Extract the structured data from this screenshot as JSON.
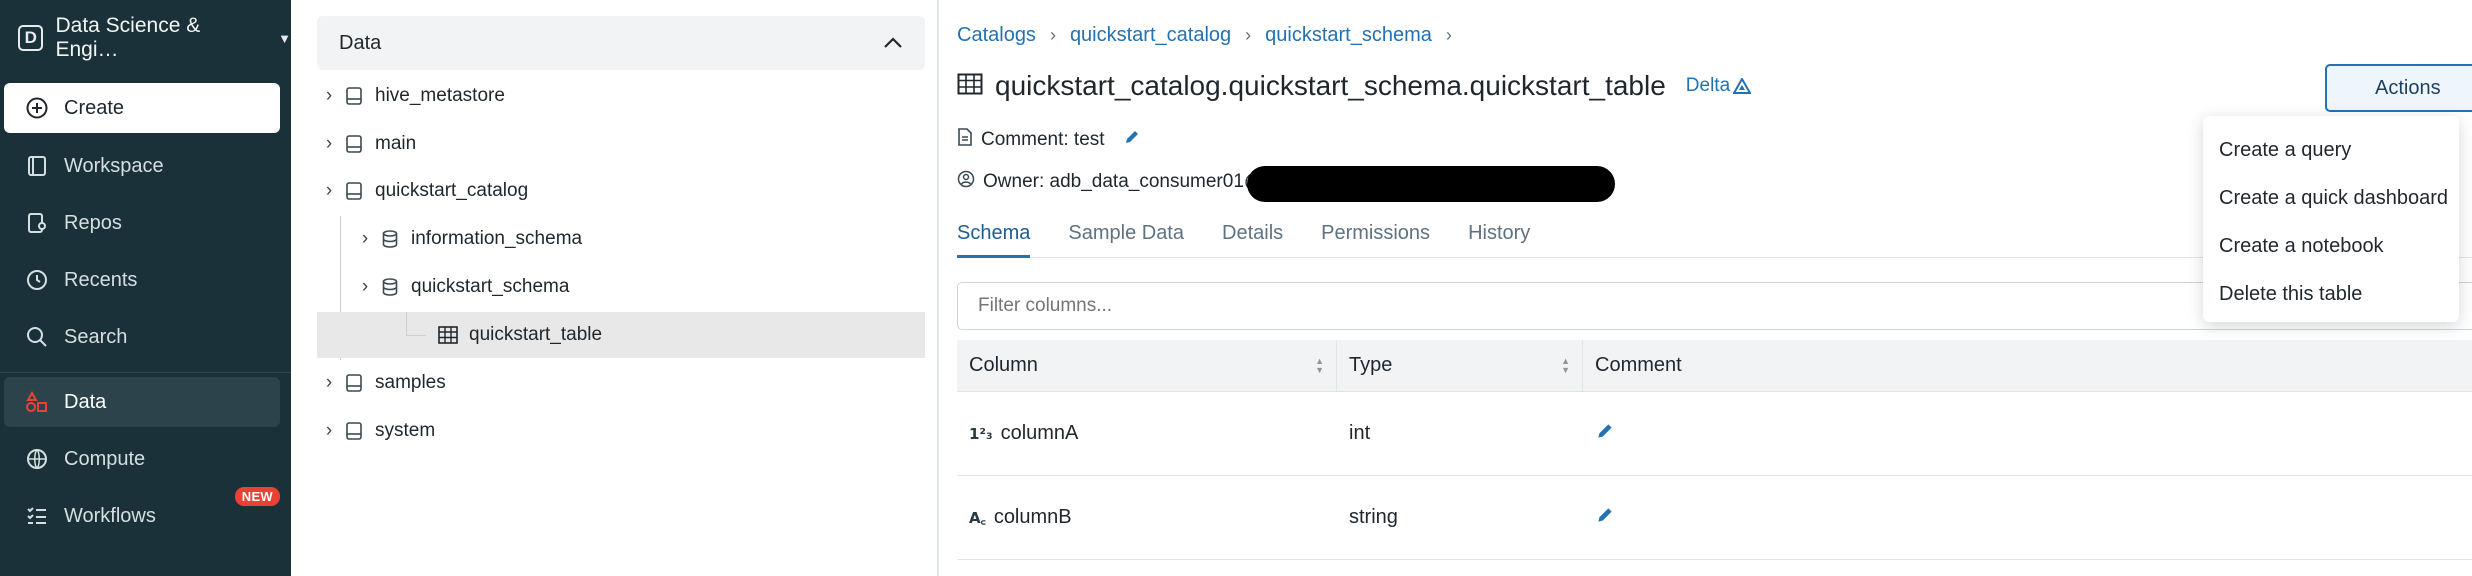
{
  "workspace": {
    "badge": "D",
    "name": "Data Science & Engi…"
  },
  "nav": {
    "create": "Create",
    "workspace": "Workspace",
    "repos": "Repos",
    "recents": "Recents",
    "search": "Search",
    "data": "Data",
    "compute": "Compute",
    "workflows": "Workflows",
    "workflows_badge": "NEW"
  },
  "tree": {
    "header": "Data",
    "items": [
      {
        "label": "hive_metastore"
      },
      {
        "label": "main"
      },
      {
        "label": "quickstart_catalog"
      },
      {
        "label": "information_schema"
      },
      {
        "label": "quickstart_schema"
      },
      {
        "label": "quickstart_table"
      },
      {
        "label": "samples"
      },
      {
        "label": "system"
      }
    ]
  },
  "breadcrumb": [
    "Catalogs",
    "quickstart_catalog",
    "quickstart_schema"
  ],
  "title": "quickstart_catalog.quickstart_schema.quickstart_table",
  "format_badge": "Delta",
  "actions_label": "Actions",
  "comment": "Comment: test",
  "owner": "Owner: adb_data_consumer01@",
  "tabs": [
    "Schema",
    "Sample Data",
    "Details",
    "Permissions",
    "History"
  ],
  "filter_placeholder": "Filter columns...",
  "columns_header": {
    "column": "Column",
    "type": "Type",
    "comment": "Comment"
  },
  "rows": [
    {
      "icon": "1²₃",
      "name": "columnA",
      "type": "int"
    },
    {
      "icon": "A꜀",
      "name": "columnB",
      "type": "string"
    }
  ],
  "actions_menu": [
    "Create a query",
    "Create a quick dashboard",
    "Create a notebook",
    "Delete this table"
  ],
  "colors": {
    "sidebar": "#1b3139",
    "accent": "#2272b4",
    "data_icon": "#e84136"
  }
}
